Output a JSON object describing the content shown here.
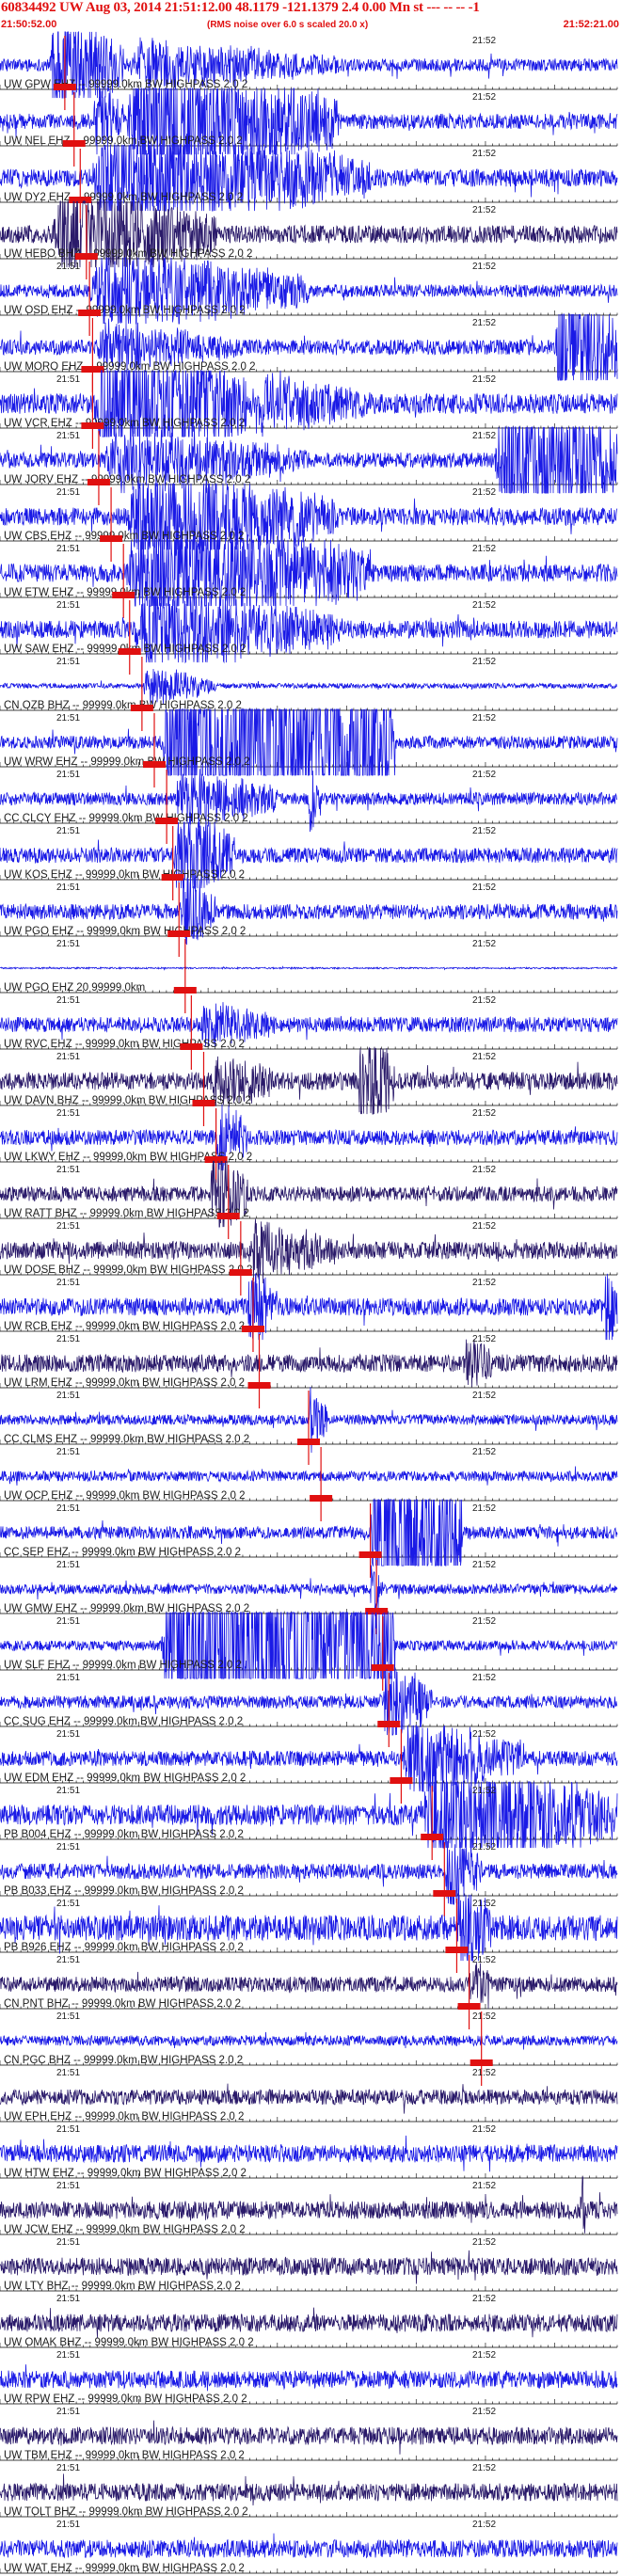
{
  "header": {
    "title": "60834492 UW Aug 03, 2014 21:51:12.00   48.1179 -121.1379  2.4 0.00 Mn st --- -- --   -1",
    "start_time": "21:50:52.00",
    "end_time": "21:52:21.00",
    "note": "(RMS noise over 6.0 s scaled 20.0 x)"
  },
  "colors": {
    "trace_blue": "#1a1ae6",
    "trace_dark": "#2a1a6a",
    "pick": "#e01010",
    "text": "#202020"
  },
  "chart_data": {
    "type": "line",
    "title": "60834492 UW Aug 03, 2014 21:51:12.00   48.1179 -121.1379  2.4 0.00 Mn st --- -- --   -1",
    "time_range": [
      "21:50:52.00",
      "21:52:21.00"
    ],
    "traces": [
      {
        "label": "UW GPW EHZ -- 99999.0km BW  HIGHPASS  2.0  2",
        "tick_label_a": "",
        "tick_label_b": "21:52",
        "pick": 0.105,
        "env": [
          [
            0.08,
            0.2,
            3
          ],
          [
            0.2,
            0.55,
            1.2
          ]
        ],
        "base": 0.25,
        "dark": false
      },
      {
        "label": "UW NEL EHZ -- 99999.0km BW  HIGHPASS  2.0  2",
        "tick_label_a": "",
        "tick_label_b": "21:52",
        "pick": 0.12,
        "env": [
          [
            0.2,
            0.55,
            3.5
          ],
          [
            0.15,
            0.2,
            2
          ]
        ],
        "base": 0.3,
        "dark": false
      },
      {
        "label": "UW DY2 EHZ -- 99999.0km BW  HIGHPASS  2.0  2",
        "tick_label_a": "",
        "tick_label_b": "21:52",
        "pick": 0.13,
        "env": [
          [
            0.14,
            0.6,
            2.5
          ]
        ],
        "base": 0.35,
        "dark": false
      },
      {
        "label": "UW HEBO BHZ -- 99999.0km BW  HIGHPASS  2.0  2",
        "tick_label_a": "",
        "tick_label_b": "21:52",
        "pick": 0.14,
        "env": [
          [
            0.08,
            0.35,
            2.5
          ]
        ],
        "base": 0.35,
        "dark": true
      },
      {
        "label": "UW OSD EHZ -- 99999.0km BW  HIGHPASS  2.0  2",
        "tick_label_a": "21:51",
        "tick_label_b": "21:52",
        "pick": 0.145,
        "env": [
          [
            0.14,
            0.5,
            2
          ]
        ],
        "base": 0.25,
        "dark": false
      },
      {
        "label": "UW MORO EHZ -- 99999.0km BW  HIGHPASS  2.0  2",
        "tick_label_a": "",
        "tick_label_b": "21:52",
        "pick": 0.15,
        "env": [
          [
            0.9,
            1.0,
            4
          ],
          [
            0.15,
            0.4,
            1.2
          ]
        ],
        "base": 0.3,
        "dark": false
      },
      {
        "label": "UW VCR EHZ -- 99999.0km BW  HIGHPASS  2.0  2",
        "tick_label_a": "21:51",
        "tick_label_b": "21:52",
        "pick": 0.15,
        "env": [
          [
            0.15,
            0.4,
            4
          ],
          [
            0.4,
            0.6,
            1.5
          ]
        ],
        "base": 0.4,
        "dark": false
      },
      {
        "label": "UW JORV EHZ -- 99999.0km BW  HIGHPASS  2.0  2",
        "tick_label_a": "21:51",
        "tick_label_b": "21:52",
        "pick": 0.16,
        "env": [
          [
            0.8,
            1.0,
            4
          ],
          [
            0.16,
            0.5,
            1.5
          ]
        ],
        "base": 0.3,
        "dark": false
      },
      {
        "label": "UW CBS EHZ -- 99999.0km BW  HIGHPASS  2.0  2",
        "tick_label_a": "21:51",
        "tick_label_b": "21:52",
        "pick": 0.18,
        "env": [
          [
            0.2,
            0.55,
            2.5
          ]
        ],
        "base": 0.35,
        "dark": false
      },
      {
        "label": "UW ETW EHZ -- 99999.0km BW  HIGHPASS  2.0  2",
        "tick_label_a": "21:51",
        "tick_label_b": "21:52",
        "pick": 0.2,
        "env": [
          [
            0.2,
            0.6,
            3
          ]
        ],
        "base": 0.35,
        "dark": false
      },
      {
        "label": "UW SAW EHZ -- 99999.0km BW  HIGHPASS  2.0  2",
        "tick_label_a": "21:51",
        "tick_label_b": "21:52",
        "pick": 0.21,
        "env": [
          [
            0.21,
            0.55,
            2
          ]
        ],
        "base": 0.35,
        "dark": false
      },
      {
        "label": "CN OZB BHZ -- 99999.0km BW  HIGHPASS  2.0  2",
        "tick_label_a": "21:51",
        "tick_label_b": "21:52",
        "pick": 0.23,
        "env": [
          [
            0.23,
            0.35,
            1
          ]
        ],
        "base": 0.1,
        "dark": false
      },
      {
        "label": "UW WRW EHZ -- 99999.0km BW  HIGHPASS  2.0  2",
        "tick_label_a": "21:51",
        "tick_label_b": "21:52",
        "pick": 0.25,
        "env": [
          [
            0.26,
            0.64,
            8
          ]
        ],
        "base": 0.25,
        "dark": false
      },
      {
        "label": "CC CLCY EHZ -- 99999.0km BW  HIGHPASS  2.0  2",
        "tick_label_a": "21:51",
        "tick_label_b": "21:52",
        "pick": 0.27,
        "env": [
          [
            0.28,
            0.45,
            1.5
          ],
          [
            0.5,
            0.52,
            2
          ]
        ],
        "base": 0.25,
        "dark": false
      },
      {
        "label": "UW KOS EHZ -- 99999.0km BW  HIGHPASS  2.0  2",
        "tick_label_a": "21:51",
        "tick_label_b": "21:52",
        "pick": 0.28,
        "env": [
          [
            0.28,
            0.38,
            2.5
          ]
        ],
        "base": 0.3,
        "dark": false
      },
      {
        "label": "UW PGO EHZ -- 99999.0km BW  HIGHPASS  2.0  2",
        "tick_label_a": "21:51",
        "tick_label_b": "21:52",
        "pick": 0.29,
        "env": [
          [
            0.29,
            0.35,
            2
          ]
        ],
        "base": 0.3,
        "dark": false
      },
      {
        "label": "UW PGO EHZ 20 99999.0km",
        "tick_label_a": "21:51",
        "tick_label_b": "21:52",
        "pick": 0.3,
        "env": [],
        "base": 0.03,
        "dark": false
      },
      {
        "label": "UW RVC EHZ -- 99999.0km BW  HIGHPASS  2.0  2",
        "tick_label_a": "21:51",
        "tick_label_b": "21:52",
        "pick": 0.31,
        "env": [
          [
            0.32,
            0.45,
            1.2
          ]
        ],
        "base": 0.3,
        "dark": false
      },
      {
        "label": "UW DAVN BHZ -- 99999.0km BW  HIGHPASS  2.0  2",
        "tick_label_a": "21:51",
        "tick_label_b": "21:52",
        "pick": 0.33,
        "env": [
          [
            0.58,
            0.64,
            3
          ],
          [
            0.34,
            0.45,
            1.5
          ]
        ],
        "base": 0.35,
        "dark": true
      },
      {
        "label": "UW LKWY EHZ -- 99999.0km BW  HIGHPASS  2.0  2",
        "tick_label_a": "21:51",
        "tick_label_b": "21:52",
        "pick": 0.35,
        "env": [
          [
            0.35,
            0.4,
            2
          ]
        ],
        "base": 0.3,
        "dark": false
      },
      {
        "label": "UW RATT BHZ -- 99999.0km BW  HIGHPASS  2.0  2",
        "tick_label_a": "21:51",
        "tick_label_b": "21:52",
        "pick": 0.37,
        "env": [
          [
            0.34,
            0.4,
            2.5
          ]
        ],
        "base": 0.3,
        "dark": true
      },
      {
        "label": "UW DOSE BHZ -- 99999.0km BW  HIGHPASS  2.0  2",
        "tick_label_a": "21:51",
        "tick_label_b": "21:52",
        "pick": 0.39,
        "env": [
          [
            0.4,
            0.55,
            1.5
          ]
        ],
        "base": 0.35,
        "dark": true
      },
      {
        "label": "UW RCB EHZ -- 99999.0km BW  HIGHPASS  2.0  2",
        "tick_label_a": "21:51",
        "tick_label_b": "21:52",
        "pick": 0.41,
        "env": [
          [
            0.4,
            0.45,
            2
          ],
          [
            0.98,
            1.0,
            3
          ]
        ],
        "base": 0.35,
        "dark": false
      },
      {
        "label": "UW LRM EHZ -- 99999.0km BW  HIGHPASS  2.0  2",
        "tick_label_a": "21:51",
        "tick_label_b": "21:52",
        "pick": 0.42,
        "env": [
          [
            0.75,
            0.8,
            1.5
          ]
        ],
        "base": 0.35,
        "dark": true
      },
      {
        "label": "CC CLMS EHZ -- 99999.0km BW  HIGHPASS  2.0  2",
        "tick_label_a": "21:51",
        "tick_label_b": "21:52",
        "pick": 0.5,
        "env": [
          [
            0.5,
            0.53,
            2
          ]
        ],
        "base": 0.2,
        "dark": false
      },
      {
        "label": "UW OCP EHZ -- 99999.0km BW  HIGHPASS  2.0  2",
        "tick_label_a": "21:51",
        "tick_label_b": "21:52",
        "pick": 0.52,
        "env": [],
        "base": 0.2,
        "dark": false
      },
      {
        "label": "CC SEP EHZ -- 99999.0km BW  HIGHPASS  2.0  2",
        "tick_label_a": "21:51",
        "tick_label_b": "21:52",
        "pick": 0.6,
        "env": [
          [
            0.6,
            0.75,
            7
          ]
        ],
        "base": 0.25,
        "dark": false
      },
      {
        "label": "UW GMW EHZ -- 99999.0km BW  HIGHPASS  2.0  2",
        "tick_label_a": "21:51",
        "tick_label_b": "21:52",
        "pick": 0.61,
        "env": [
          [
            0.6,
            0.62,
            1.5
          ]
        ],
        "base": 0.2,
        "dark": false
      },
      {
        "label": "UW SLF EHZ -- 99999.0km BW  HIGHPASS  2.0  2",
        "tick_label_a": "21:51",
        "tick_label_b": "21:52",
        "pick": 0.62,
        "env": [
          [
            0.26,
            0.64,
            10
          ]
        ],
        "base": 0.2,
        "dark": false
      },
      {
        "label": "CC SUG EHZ -- 99999.0km BW  HIGHPASS  2.0  2",
        "tick_label_a": "21:51",
        "tick_label_b": "21:52",
        "pick": 0.63,
        "env": [
          [
            0.62,
            0.7,
            2
          ]
        ],
        "base": 0.25,
        "dark": false
      },
      {
        "label": "UW EDM EHZ -- 99999.0km BW  HIGHPASS  2.0  2",
        "tick_label_a": "21:51",
        "tick_label_b": "21:52",
        "pick": 0.65,
        "env": [
          [
            0.65,
            0.85,
            2
          ]
        ],
        "base": 0.3,
        "dark": false
      },
      {
        "label": "PB B004 EHZ -- 99999.0km BW  HIGHPASS  2.0  2",
        "tick_label_a": "21:51",
        "tick_label_b": "21:52",
        "pick": 0.7,
        "env": [
          [
            0.68,
            1.0,
            3
          ]
        ],
        "base": 0.4,
        "dark": false
      },
      {
        "label": "PB B033 EHZ -- 99999.0km BW  HIGHPASS  2.0  2",
        "tick_label_a": "21:51",
        "tick_label_b": "21:52",
        "pick": 0.72,
        "env": [
          [
            0.72,
            0.78,
            2
          ]
        ],
        "base": 0.3,
        "dark": false
      },
      {
        "label": "PB B926 EHZ -- 99999.0km BW  HIGHPASS  2.0  2",
        "tick_label_a": "21:51",
        "tick_label_b": "21:52",
        "pick": 0.74,
        "env": [
          [
            0.74,
            0.8,
            2.5
          ]
        ],
        "base": 0.5,
        "dark": false
      },
      {
        "label": "CN PNT BHZ -- 99999.0km BW  HIGHPASS  2.0  2",
        "tick_label_a": "21:51",
        "tick_label_b": "21:52",
        "pick": 0.76,
        "env": [
          [
            0.76,
            0.8,
            1.2
          ]
        ],
        "base": 0.3,
        "dark": true
      },
      {
        "label": "CN PGC BHZ -- 99999.0km BW  HIGHPASS  2.0  2",
        "tick_label_a": "21:51",
        "tick_label_b": "21:52",
        "pick": 0.78,
        "env": [],
        "base": 0.2,
        "dark": false
      },
      {
        "label": "UW EPH EHZ -- 99999.0km BW  HIGHPASS  2.0  2",
        "tick_label_a": "21:51",
        "tick_label_b": "21:52",
        "pick": null,
        "env": [],
        "base": 0.3,
        "dark": true
      },
      {
        "label": "UW HTW EHZ -- 99999.0km BW  HIGHPASS  2.0  2",
        "tick_label_a": "21:51",
        "tick_label_b": "21:52",
        "pick": null,
        "env": [],
        "base": 0.35,
        "dark": false
      },
      {
        "label": "UW JCW EHZ -- 99999.0km BW  HIGHPASS  2.0  2",
        "tick_label_a": "21:51",
        "tick_label_b": "21:52",
        "pick": null,
        "env": [
          [
            0.94,
            0.95,
            2.5
          ]
        ],
        "base": 0.35,
        "dark": true
      },
      {
        "label": "UW LTY BHZ -- 99999.0km BW  HIGHPASS  2.0  2",
        "tick_label_a": "21:51",
        "tick_label_b": "21:52",
        "pick": null,
        "env": [],
        "base": 0.35,
        "dark": true
      },
      {
        "label": "UW OMAK BHZ -- 99999.0km BW  HIGHPASS  2.0  2",
        "tick_label_a": "21:51",
        "tick_label_b": "21:52",
        "pick": null,
        "env": [],
        "base": 0.35,
        "dark": true
      },
      {
        "label": "UW RPW EHZ -- 99999.0km BW  HIGHPASS  2.0  2",
        "tick_label_a": "21:51",
        "tick_label_b": "21:52",
        "pick": null,
        "env": [],
        "base": 0.35,
        "dark": false
      },
      {
        "label": "UW TBM EHZ -- 99999.0km BW  HIGHPASS  2.0  2",
        "tick_label_a": "21:51",
        "tick_label_b": "21:52",
        "pick": null,
        "env": [],
        "base": 0.35,
        "dark": true
      },
      {
        "label": "UW TOLT BHZ -- 99999.0km BW  HIGHPASS  2.0  2",
        "tick_label_a": "21:51",
        "tick_label_b": "21:52",
        "pick": null,
        "env": [],
        "base": 0.35,
        "dark": true
      },
      {
        "label": "UW WAT EHZ -- 99999.0km BW  HIGHPASS  2.0  2",
        "tick_label_a": "21:51",
        "tick_label_b": "21:52",
        "pick": null,
        "env": [],
        "base": 0.35,
        "dark": false
      }
    ]
  }
}
